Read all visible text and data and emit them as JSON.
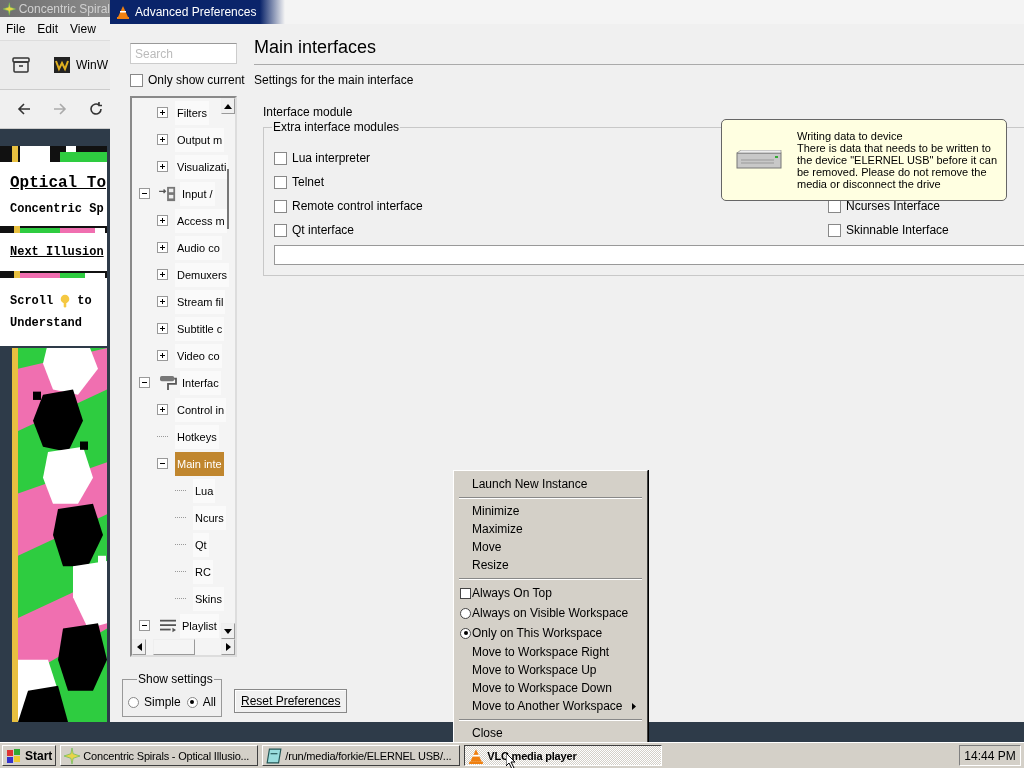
{
  "browser": {
    "title": "Concentric Spiral",
    "menu": [
      "File",
      "Edit",
      "View"
    ],
    "bookmark": "WinW",
    "page": {
      "heading": "Optical To",
      "subheading": "Concentric Sp",
      "link": "Next Illusion",
      "hint_before": "Scroll",
      "hint_after": "to",
      "hint_end": "Understand"
    }
  },
  "prefs": {
    "title": "Advanced Preferences",
    "search": {
      "placeholder": "Search"
    },
    "only_current": {
      "label": "Only show current",
      "checked": false
    },
    "tree": {
      "partial": [
        {
          "label": "Filters",
          "expanded": false,
          "selected": false
        },
        {
          "label": "Output m",
          "expanded": false,
          "selected": false
        },
        {
          "label": "Visualizati",
          "expanded": false,
          "selected": false
        }
      ],
      "items": [
        {
          "label": "Input /",
          "kind": "input",
          "expanded": true,
          "selected": false,
          "children": [
            {
              "label": "Access m",
              "expanded": false,
              "selected": false
            },
            {
              "label": "Audio co",
              "expanded": false,
              "selected": false
            },
            {
              "label": "Demuxers",
              "expanded": false,
              "selected": false
            },
            {
              "label": "Stream fil",
              "expanded": false,
              "selected": false
            },
            {
              "label": "Subtitle c",
              "expanded": false,
              "selected": false
            },
            {
              "label": "Video co",
              "expanded": false,
              "selected": false
            }
          ]
        },
        {
          "label": "Interfac",
          "kind": "interface",
          "expanded": true,
          "selected": false,
          "children": [
            {
              "label": "Control in",
              "expanded": false,
              "selected": false
            },
            {
              "label": "Hotkeys",
              "selected": false
            },
            {
              "label": "Main inte",
              "expanded": true,
              "selected": true,
              "children": [
                {
                  "label": "Lua",
                  "selected": false
                },
                {
                  "label": "Ncurs",
                  "selected": false
                },
                {
                  "label": "Qt",
                  "selected": false
                },
                {
                  "label": "RC",
                  "selected": false
                },
                {
                  "label": "Skins",
                  "selected": false
                }
              ]
            }
          ]
        },
        {
          "label": "Playlist",
          "kind": "playlist",
          "expanded": true,
          "selected": false
        }
      ]
    },
    "show_settings": {
      "label": "Show settings",
      "options": [
        {
          "label": "Simple",
          "selected": false
        },
        {
          "label": "All",
          "selected": true
        }
      ]
    },
    "reset_button": "Reset Preferences",
    "panel": {
      "title": "Main interfaces",
      "description": "Settings for the main interface",
      "module_label": "Interface module",
      "extra": {
        "label": "Extra interface modules",
        "left": [
          {
            "label": "Lua interpreter",
            "checked": false
          },
          {
            "label": "Telnet",
            "checked": false
          },
          {
            "label": "Remote control interface",
            "checked": false
          },
          {
            "label": "Qt interface",
            "checked": false
          }
        ],
        "right": [
          {
            "label": "Ncurses Interface",
            "checked": false
          },
          {
            "label": "Skinnable Interface",
            "checked": false
          }
        ]
      }
    }
  },
  "notification": {
    "title": "Writing data to device",
    "body": "There is data that needs to be written to the device \"ELERNEL USB\" before it can be removed. Please do not remove the media or disconnect the drive"
  },
  "context_menu": {
    "items": [
      {
        "kind": "item",
        "label": "Launch New Instance"
      },
      {
        "kind": "separator"
      },
      {
        "kind": "item",
        "label": "Minimize"
      },
      {
        "kind": "item",
        "label": "Maximize"
      },
      {
        "kind": "item",
        "label": "Move"
      },
      {
        "kind": "item",
        "label": "Resize"
      },
      {
        "kind": "separator"
      },
      {
        "kind": "check",
        "label": "Always On Top",
        "checked": false
      },
      {
        "kind": "radio",
        "label": "Always on Visible Workspace",
        "selected": false
      },
      {
        "kind": "radio",
        "label": "Only on This Workspace",
        "selected": true
      },
      {
        "kind": "item",
        "label": "Move to Workspace Right"
      },
      {
        "kind": "item",
        "label": "Move to Workspace Up"
      },
      {
        "kind": "item",
        "label": "Move to Workspace Down"
      },
      {
        "kind": "submenu",
        "label": "Move to Another Workspace"
      },
      {
        "kind": "separator"
      },
      {
        "kind": "item",
        "label": "Close"
      }
    ]
  },
  "taskbar": {
    "start": "Start",
    "tasks": [
      {
        "kind": "browser",
        "label": "Concentric Spirals - Optical Illusio...",
        "selected": false
      },
      {
        "kind": "folder",
        "label": "/run/media/forkie/ELERNEL USB/...",
        "selected": false
      },
      {
        "kind": "vlc",
        "label": "VLC media player",
        "selected": true
      }
    ],
    "clock": "14:44 PM"
  }
}
